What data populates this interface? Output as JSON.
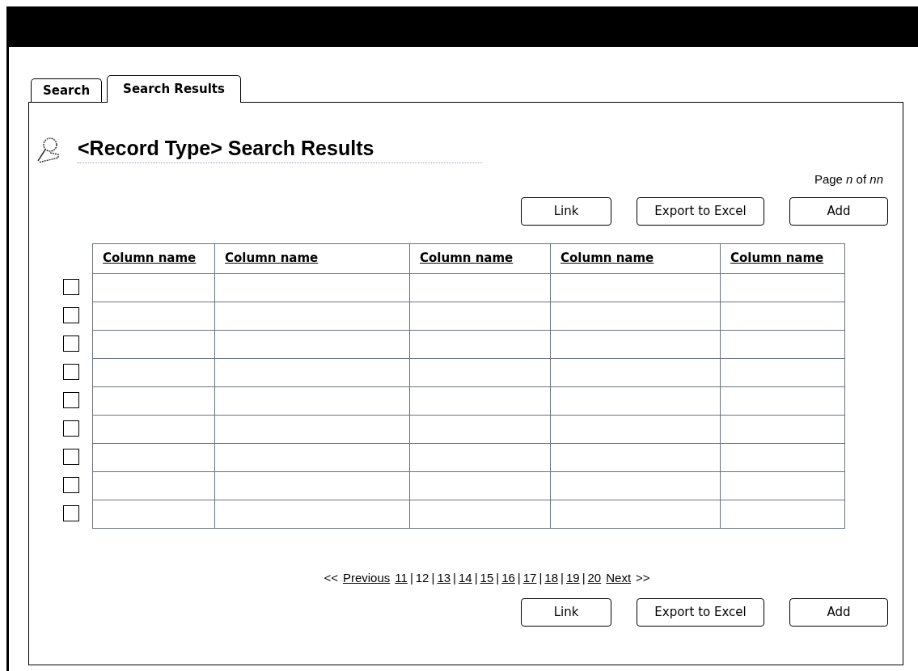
{
  "tabs": [
    {
      "label": "Search",
      "selected": false
    },
    {
      "label": "Search Results",
      "selected": true
    }
  ],
  "title": "<Record Type> Search Results",
  "page_indicator": "Page *n* of  *nn*",
  "top_buttons": [
    "Link",
    "Export to Excel",
    "Add"
  ],
  "table": {
    "columns": [
      "Column name",
      "Column name",
      "Column name",
      "Column name",
      "Column name"
    ],
    "rows": [
      {
        "checked": false
      },
      {
        "checked": false
      },
      {
        "checked": false
      },
      {
        "checked": false
      },
      {
        "checked": false
      },
      {
        "checked": false
      },
      {
        "checked": false
      },
      {
        "checked": false
      },
      {
        "checked": false
      }
    ]
  },
  "pagination": [
    {
      "kind": "text",
      "label": "<<"
    },
    {
      "kind": "link",
      "label": "Previous"
    },
    {
      "kind": "link",
      "label": "11",
      "selected": false
    },
    {
      "kind": "separator",
      "label": "|"
    },
    {
      "kind": "link",
      "label": "12",
      "selected": true
    },
    {
      "kind": "separator",
      "label": "|"
    },
    {
      "kind": "link",
      "label": "13",
      "selected": false
    },
    {
      "kind": "separator",
      "label": "|"
    },
    {
      "kind": "link",
      "label": "14",
      "selected": false
    },
    {
      "kind": "separator",
      "label": "|"
    },
    {
      "kind": "link",
      "label": "15",
      "selected": false
    },
    {
      "kind": "separator",
      "label": "|"
    },
    {
      "kind": "link",
      "label": "16",
      "selected": false
    },
    {
      "kind": "separator",
      "label": "|"
    },
    {
      "kind": "link",
      "label": "17",
      "selected": false
    },
    {
      "kind": "separator",
      "label": "|"
    },
    {
      "kind": "link",
      "label": "18",
      "selected": false
    },
    {
      "kind": "separator",
      "label": "|"
    },
    {
      "kind": "link",
      "label": "19",
      "selected": false
    },
    {
      "kind": "separator",
      "label": "|"
    },
    {
      "kind": "link",
      "label": "20",
      "selected": false
    },
    {
      "kind": "link",
      "label": "Next"
    },
    {
      "kind": "text",
      "label": ">>"
    }
  ],
  "bottom_buttons": [
    "Link",
    "Export to Excel",
    "Add"
  ]
}
